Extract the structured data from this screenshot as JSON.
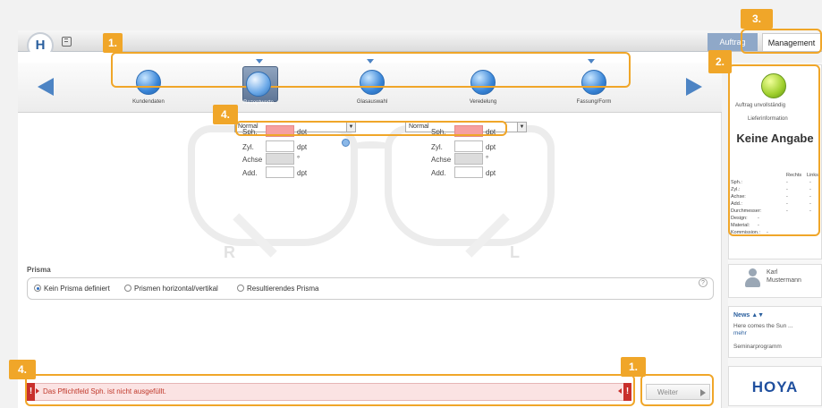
{
  "header": {
    "logo": "H",
    "tabs": [
      "Auftrag",
      "Management"
    ]
  },
  "steps": [
    "Kundendaten",
    "Rezeptwerte",
    "Glasauswahl",
    "Veredelung",
    "Fassung/Form"
  ],
  "rx": {
    "mode_right": "Normal",
    "mode_left": "Normal",
    "labels": [
      "Sph.",
      "Zyl.",
      "Achse",
      "Add."
    ],
    "units": [
      "dpt",
      "dpt",
      "°",
      "dpt"
    ],
    "side_letters": [
      "R",
      "L"
    ]
  },
  "prisma": {
    "title": "Prisma",
    "options": [
      "Kein Prisma definiert",
      "Prismen horizontal/vertikal",
      "Resultierendes Prisma"
    ],
    "selected": 0
  },
  "error": {
    "message": "Das Pflichtfeld Sph. ist nicht ausgefüllt.",
    "icon": "!"
  },
  "footer": {
    "next_label": "Weiter"
  },
  "sidebar": {
    "status": "Auftrag unvollständig",
    "delivery_title": "Lieferinformation",
    "delivery_value": "Keine Angabe",
    "table_headers": [
      "Rechts",
      "Links"
    ],
    "rows": [
      {
        "label": "Sph.:",
        "r": "-",
        "l": "-"
      },
      {
        "label": "Zyl.:",
        "r": "-",
        "l": "-"
      },
      {
        "label": "Achse:",
        "r": "-",
        "l": "-"
      },
      {
        "label": "Add.:",
        "r": "-",
        "l": "-"
      },
      {
        "label": "Durchmesser:",
        "r": "-",
        "l": "-"
      },
      {
        "label": "Design:",
        "r": "-",
        "l": ""
      },
      {
        "label": "Material:",
        "r": "-",
        "l": ""
      },
      {
        "label": "Kommission.:",
        "r": "-",
        "l": ""
      }
    ],
    "user_first": "Karl",
    "user_last": "Mustermann",
    "news_title": "News",
    "news_sort": "▲▼",
    "news_text": "Here comes the Sun ...",
    "news_more": "mehr",
    "seminar": "Seminarprogramm",
    "brand": "HOYA"
  },
  "annotations": [
    "1.",
    "2.",
    "3.",
    "4.",
    "4.",
    "1."
  ],
  "colors": {
    "accent": "#f0a629",
    "primary": "#4d84c4",
    "error": "#c9302c",
    "required": "#f6a0a0"
  }
}
